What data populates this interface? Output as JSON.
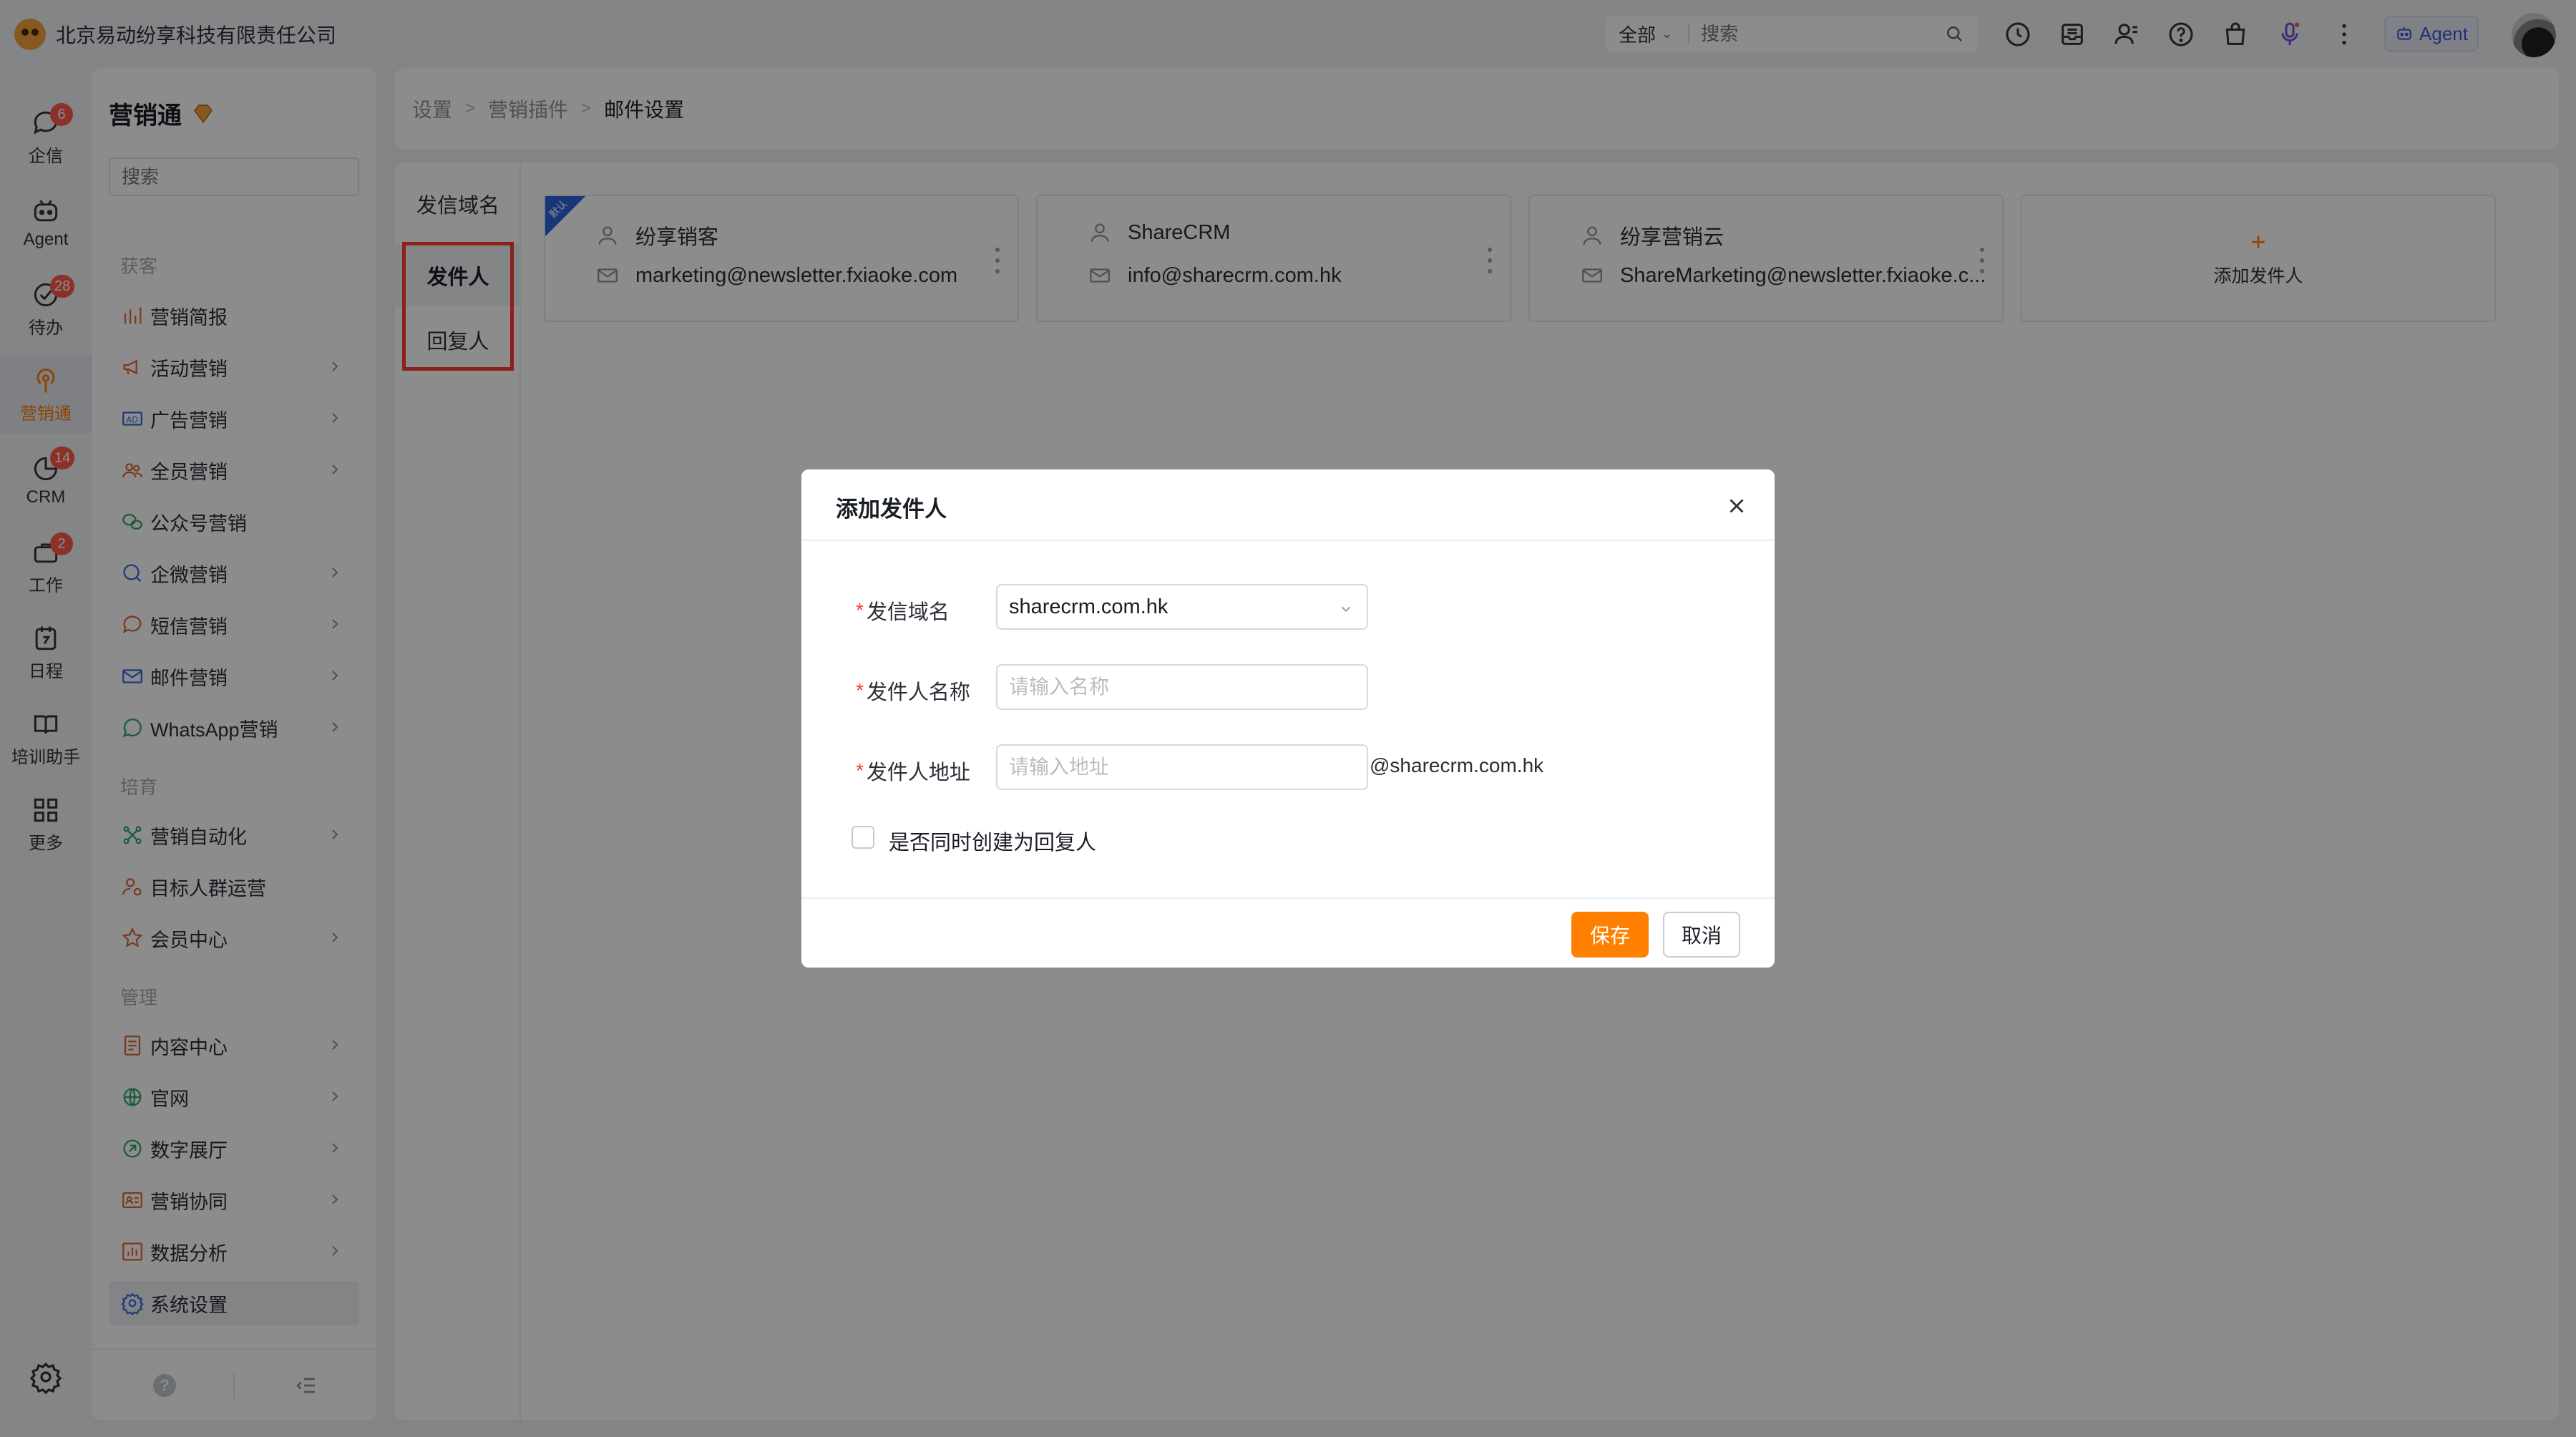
{
  "company_name": "北京易动纷享科技有限责任公司",
  "topbar": {
    "search_scope": "全部",
    "search_placeholder": "搜索",
    "agent_label": "Agent"
  },
  "rail": {
    "items": [
      {
        "label": "企信",
        "badge": "6"
      },
      {
        "label": "Agent",
        "badge": ""
      },
      {
        "label": "待办",
        "badge": "28"
      },
      {
        "label": "营销通",
        "badge": ""
      },
      {
        "label": "CRM",
        "badge": "14"
      },
      {
        "label": "工作",
        "badge": "2"
      },
      {
        "label": "日程",
        "badge": ""
      },
      {
        "label": "培训助手",
        "badge": ""
      },
      {
        "label": "更多",
        "badge": ""
      }
    ]
  },
  "menu": {
    "title": "营销通",
    "search_placeholder": "搜索",
    "groups": {
      "acquire": "获客",
      "nurture": "培育",
      "manage": "管理"
    },
    "items": {
      "report": "营销简报",
      "activity": "活动营销",
      "ads": "广告营销",
      "staff": "全员营销",
      "official": "公众号营销",
      "wecom": "企微营销",
      "sms": "短信营销",
      "email": "邮件营销",
      "whatsapp": "WhatsApp营销",
      "automation": "营销自动化",
      "audience": "目标人群运营",
      "member": "会员中心",
      "content": "内容中心",
      "website": "官网",
      "digital_hall": "数字展厅",
      "collab": "营销协同",
      "analytics": "数据分析",
      "settings": "系统设置"
    }
  },
  "breadcrumb": {
    "level1": "设置",
    "level2": "营销插件",
    "level3": "邮件设置",
    "separator": ">"
  },
  "side_tabs": {
    "domain": "发信域名",
    "sender": "发件人",
    "replier": "回复人"
  },
  "sender_cards": [
    {
      "name": "纷享销客",
      "email": "marketing@newsletter.fxiaoke.com",
      "ribbon": "默认"
    },
    {
      "name": "ShareCRM",
      "email": "info@sharecrm.com.hk",
      "ribbon": ""
    },
    {
      "name": "纷享营销云",
      "email": "ShareMarketing@newsletter.fxiaoke.c...",
      "ribbon": ""
    }
  ],
  "add_card": {
    "plus": "+",
    "label": "添加发件人"
  },
  "dialog": {
    "title": "添加发件人",
    "domain_label": "发信域名",
    "domain_value": "sharecrm.com.hk",
    "name_label": "发件人名称",
    "name_placeholder": "请输入名称",
    "address_label": "发件人地址",
    "address_placeholder": "请输入地址",
    "address_suffix": "@sharecrm.com.hk",
    "checkbox_label": "是否同时创建为回复人",
    "required_mark": "*",
    "save": "保存",
    "cancel": "取消"
  },
  "colors": {
    "accent": "#ff8000",
    "required": "#ff3b30",
    "badge": "#ff5a4e",
    "highlight_box": "#ff3b30"
  }
}
